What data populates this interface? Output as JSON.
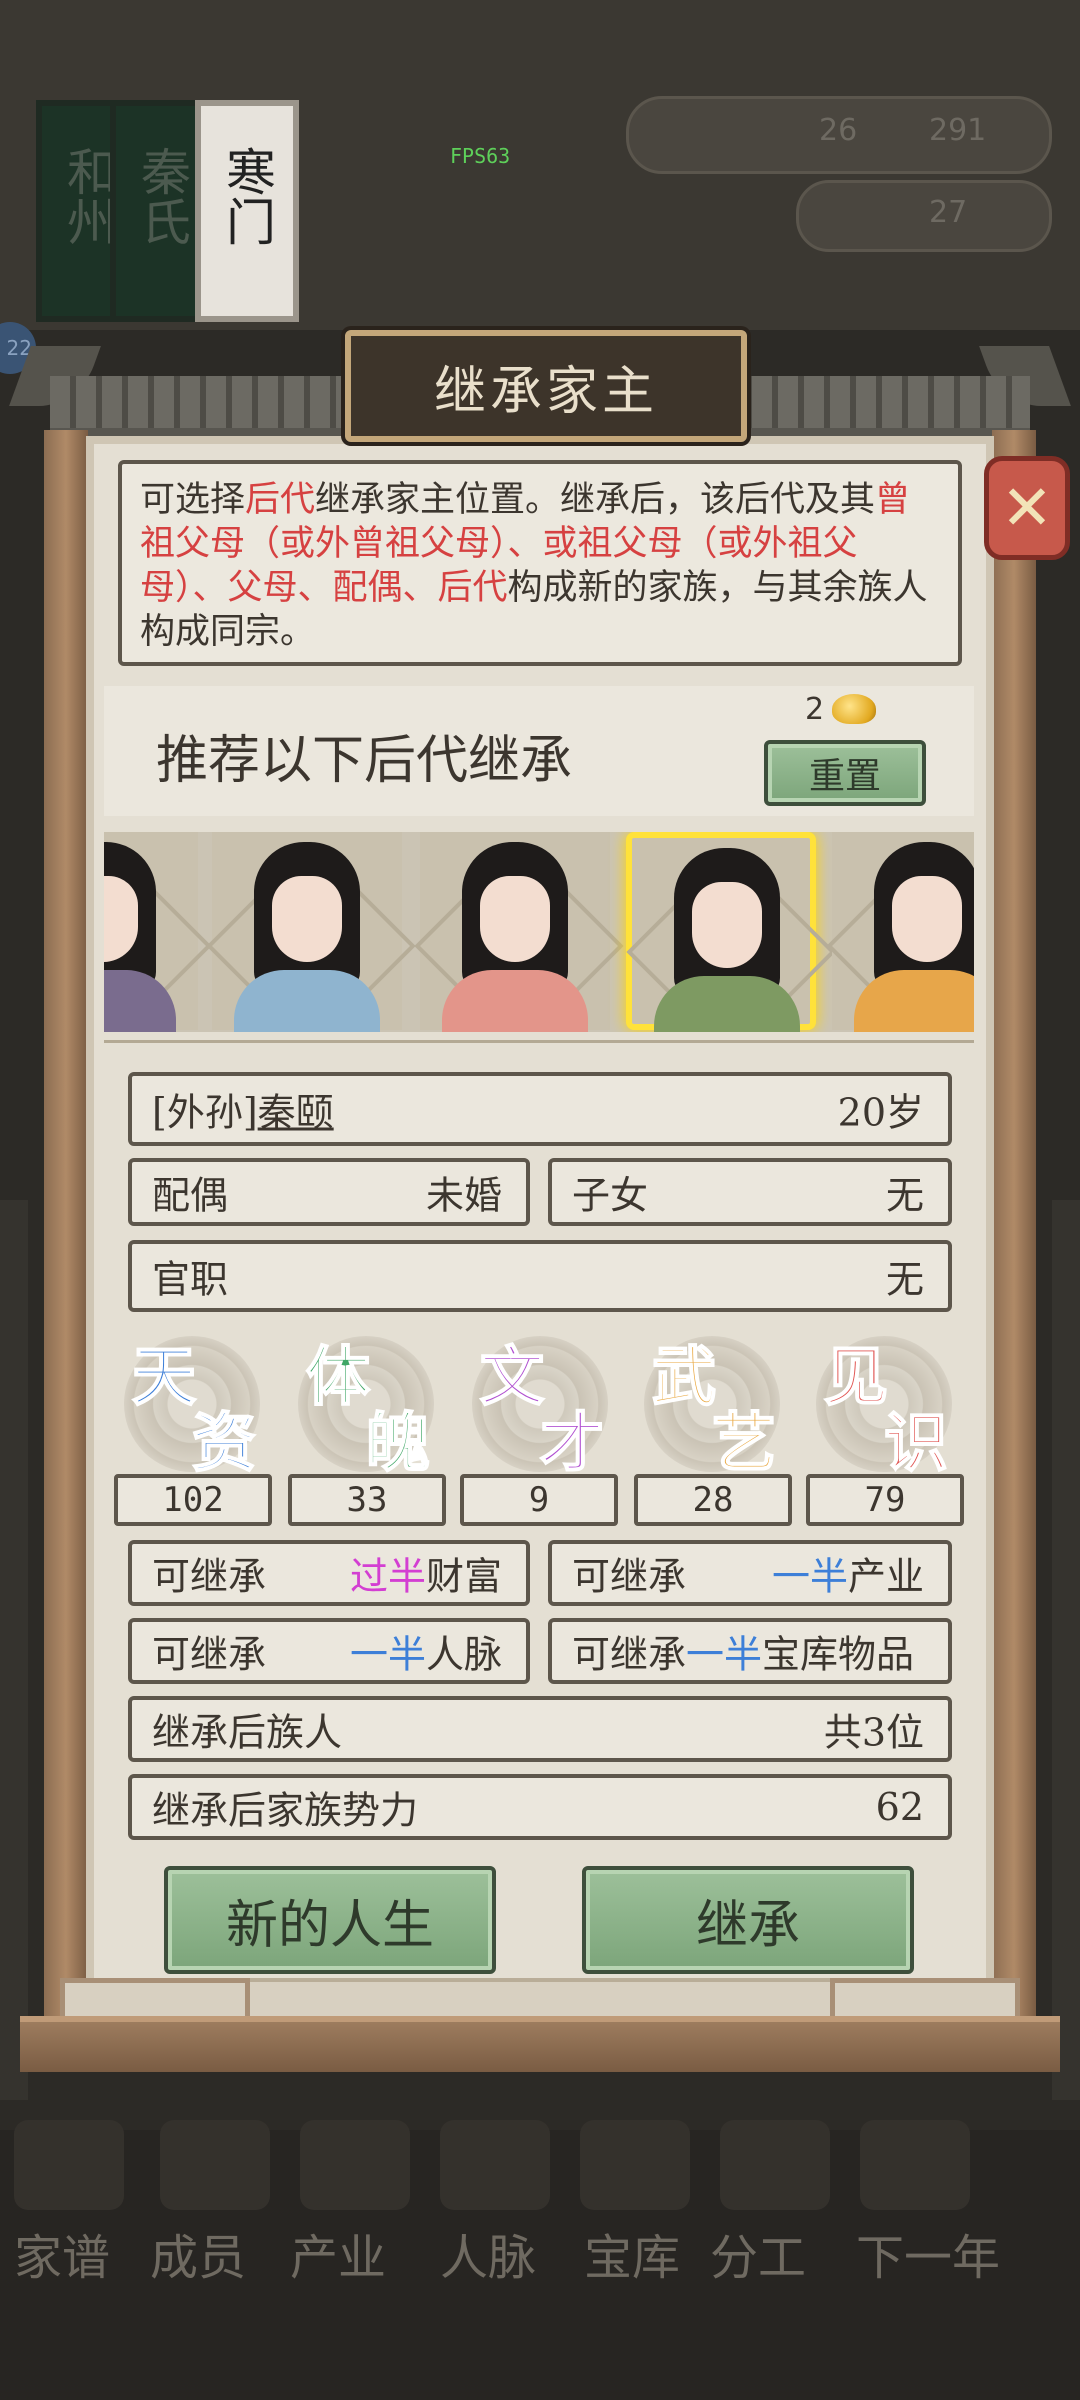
{
  "background": {
    "books": [
      "和州",
      "秦氏",
      "寒门"
    ],
    "resource_a": "26",
    "resource_b": "291",
    "resource_c": "27",
    "fps": "FPS63",
    "badge": "22"
  },
  "bottom_nav": [
    "家谱",
    "成员",
    "产业",
    "人脉",
    "宝库",
    "分工",
    "下一年"
  ],
  "modal": {
    "title": "继承家主",
    "close_icon": "close-x-icon",
    "description_parts": [
      {
        "text": "可选择",
        "hl": false
      },
      {
        "text": "后代",
        "hl": true
      },
      {
        "text": "继承家主位置。继承后，该后代及其",
        "hl": false
      },
      {
        "text": "曾祖父母（或外曾祖父母）、或祖父母（或外祖父母）、父母、配偶、后代",
        "hl": true
      },
      {
        "text": "构成新的家族，与其余族人构成同宗。",
        "hl": false
      }
    ],
    "recommend_text": "推荐以下后代继承",
    "reset_cost": "2",
    "reset_label": "重置",
    "highlight_color": "#d64141",
    "selected_color": "#ffe23a"
  },
  "portraits": [
    {
      "robe": "#7a6c8e",
      "selected": false
    },
    {
      "robe": "#8fb4cf",
      "selected": false
    },
    {
      "robe": "#e3958a",
      "selected": false
    },
    {
      "robe": "#7e9a62",
      "selected": true
    },
    {
      "robe": "#e7a64a",
      "selected": false
    }
  ],
  "heir": {
    "relation": "[外孙]",
    "name": "秦颐",
    "age": "20岁",
    "spouse_label": "配偶",
    "spouse_value": "未婚",
    "children_label": "子女",
    "children_value": "无",
    "office_label": "官职",
    "office_value": "无"
  },
  "attributes": [
    {
      "c1": "天",
      "c2": "资",
      "color": "#3d7fd8",
      "value": "102"
    },
    {
      "c1": "体",
      "c2": "魄",
      "color": "#3fa766",
      "value": "33"
    },
    {
      "c1": "文",
      "c2": "才",
      "color": "#b04fd0",
      "value": "9"
    },
    {
      "c1": "武",
      "c2": "艺",
      "color": "#e8a53b",
      "value": "28"
    },
    {
      "c1": "见",
      "c2": "识",
      "color": "#e0524f",
      "value": "79"
    }
  ],
  "inherit": {
    "wealth_label": "可继承",
    "wealth_q": "过半",
    "wealth_t": "财富",
    "property_label": "可继承",
    "property_q": "一半",
    "property_t": "产业",
    "network_label": "可继承",
    "network_q": "一半",
    "network_t": "人脉",
    "vault_label": "可继承",
    "vault_q": "一半",
    "vault_t": "宝库物品"
  },
  "after": {
    "members_label": "继承后族人",
    "members_value": "共3位",
    "power_label": "继承后家族势力",
    "power_value": "62"
  },
  "actions": {
    "new_life": "新的人生",
    "inherit": "继承"
  }
}
